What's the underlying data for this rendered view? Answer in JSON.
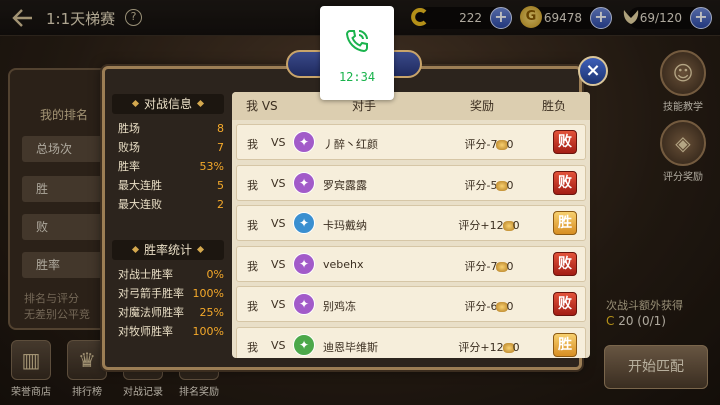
{
  "header": {
    "title": "1:1天梯赛",
    "help": "?",
    "resources": [
      {
        "icon": "c-coin-icon",
        "value": "222",
        "color": "#f0c020"
      },
      {
        "icon": "gold-coin-icon",
        "value": "69478",
        "color": "#e3b320"
      },
      {
        "icon": "wings-energy-icon",
        "value": "69/120",
        "color": "#e9d7a6"
      }
    ]
  },
  "left_panel": {
    "title": "我的排名",
    "buttons": [
      "总场次",
      "胜",
      "败",
      "胜率"
    ],
    "notes": [
      "排名与评分",
      "无差别公平竞"
    ]
  },
  "bottom_nav": [
    "荣誉商店",
    "排行榜",
    "对战记录",
    "排名奖励"
  ],
  "right_side": {
    "items": [
      "技能教学",
      "评分奖励"
    ],
    "extra_text": "次战斗额外获得",
    "extra_count": "20 (0/1)",
    "start_button": "开始匹配"
  },
  "modal": {
    "close": "×",
    "battle_info": {
      "heading": "对战信息",
      "rows": [
        {
          "label": "胜场",
          "value": "8"
        },
        {
          "label": "败场",
          "value": "7"
        },
        {
          "label": "胜率",
          "value": "53%"
        },
        {
          "label": "最大连胜",
          "value": "5"
        },
        {
          "label": "最大连败",
          "value": "2"
        }
      ]
    },
    "win_rate_stats": {
      "heading": "胜率统计",
      "rows": [
        {
          "label": "对战士胜率",
          "value": "0%"
        },
        {
          "label": "对弓箭手胜率",
          "value": "100%"
        },
        {
          "label": "对魔法师胜率",
          "value": "25%"
        },
        {
          "label": "对牧师胜率",
          "value": "100%"
        }
      ]
    },
    "table": {
      "headers": {
        "me_vs": "我  VS",
        "opponent": "对手",
        "reward": "奖励",
        "result": "胜负"
      },
      "rows": [
        {
          "me": "我",
          "vs": "VS",
          "avatar": "mage-class-icon",
          "avatar_color": "#a25bc9",
          "opponent": "丿醉丶红颜",
          "reward": "评分-7",
          "reward_gem": "0",
          "result": "败",
          "win": false
        },
        {
          "me": "我",
          "vs": "VS",
          "avatar": "mage-class-icon",
          "avatar_color": "#a25bc9",
          "opponent": "罗宾露露",
          "reward": "评分-5",
          "reward_gem": "0",
          "result": "败",
          "win": false
        },
        {
          "me": "我",
          "vs": "VS",
          "avatar": "priest-class-icon",
          "avatar_color": "#3a8fd0",
          "opponent": "卡玛戴纳",
          "reward": "评分+12",
          "reward_gem": "0",
          "result": "胜",
          "win": true
        },
        {
          "me": "我",
          "vs": "VS",
          "avatar": "mage-class-icon",
          "avatar_color": "#a25bc9",
          "opponent": "vebehx",
          "reward": "评分-7",
          "reward_gem": "0",
          "result": "败",
          "win": false
        },
        {
          "me": "我",
          "vs": "VS",
          "avatar": "mage-class-icon",
          "avatar_color": "#a25bc9",
          "opponent": "别鸡冻",
          "reward": "评分-6",
          "reward_gem": "0",
          "result": "败",
          "win": false
        },
        {
          "me": "我",
          "vs": "VS",
          "avatar": "archer-class-icon",
          "avatar_color": "#4ca84a",
          "opponent": "迪恩毕维斯",
          "reward": "评分+12",
          "reward_gem": "0",
          "result": "胜",
          "win": true
        }
      ]
    }
  },
  "call_notification": {
    "icon": "phone-icon",
    "time": "12:34",
    "color": "#1ab34d"
  }
}
